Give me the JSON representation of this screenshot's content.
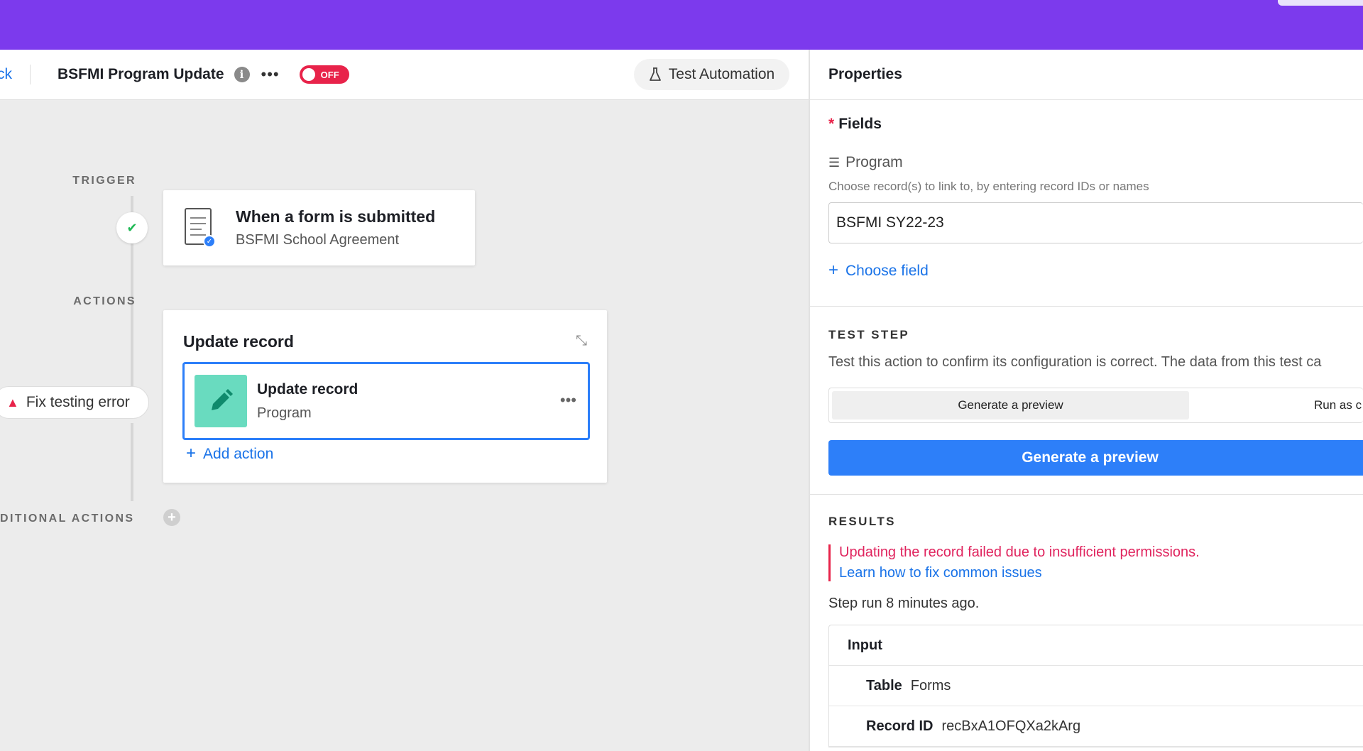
{
  "header": {
    "back_label": "ck",
    "automation_title": "BSFMI Program Update",
    "toggle_label": "OFF",
    "test_button_label": "Test Automation"
  },
  "canvas": {
    "trigger_label": "TRIGGER",
    "actions_label": "ACTIONS",
    "conditional_label": "DITIONAL ACTIONS",
    "trigger_card": {
      "title": "When a form is submitted",
      "subtitle": "BSFMI School Agreement"
    },
    "actions_card": {
      "header": "Update record",
      "item_title": "Update record",
      "item_subtitle": "Program",
      "add_action_label": "Add action"
    },
    "fix_error_label": "Fix testing error"
  },
  "properties": {
    "title": "Properties",
    "fields_label": "Fields",
    "program_label": "Program",
    "program_hint": "Choose record(s) to link to, by entering record IDs or names",
    "program_value": "BSFMI SY22-23",
    "choose_field_label": "Choose field",
    "test_step": {
      "title": "TEST STEP",
      "description": "Test this action to confirm its configuration is correct. The data from this test ca",
      "segment_selected": "Generate a preview",
      "segment_other": "Run as c",
      "button_label": "Generate a preview"
    },
    "results": {
      "title": "RESULTS",
      "error": "Updating the record failed due to insufficient permissions.",
      "learn_link": "Learn how to fix common issues",
      "step_run": "Step run 8 minutes ago.",
      "input_label": "Input",
      "rows": [
        {
          "key": "Table",
          "value": "Forms"
        },
        {
          "key": "Record ID",
          "value": "recBxA1OFQXa2kArg"
        }
      ]
    }
  },
  "colors": {
    "topbar": "#7c3aed",
    "accent": "#2d7ff9",
    "danger": "#e8234a",
    "success": "#1fb955",
    "teal": "#69dbbf"
  },
  "icons": [
    "info-icon",
    "more-icon",
    "flask-icon",
    "check-icon",
    "form-icon",
    "pencil-icon",
    "collapse-icon",
    "plus-icon",
    "warning-icon",
    "list-icon"
  ]
}
